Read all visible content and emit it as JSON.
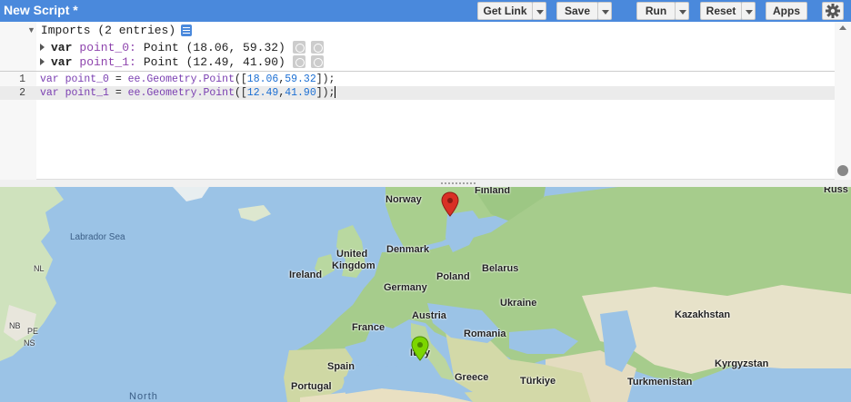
{
  "header": {
    "title": "New Script *",
    "buttons": {
      "get_link": "Get Link",
      "save": "Save",
      "run": "Run",
      "reset": "Reset",
      "apps": "Apps"
    },
    "accent_color": "#4a89dc"
  },
  "imports": {
    "heading": "Imports (2 entries)",
    "entries": [
      {
        "keyword": "var",
        "name": "point_0:",
        "value": "Point (18.06, 59.32)"
      },
      {
        "keyword": "var",
        "name": "point_1:",
        "value": "Point (12.49, 41.90)"
      }
    ]
  },
  "code": {
    "lines": [
      {
        "number": "1",
        "var": "var",
        "ident": "point_0",
        "eq": " = ",
        "call": "ee.Geometry.Point",
        "open": "([",
        "a": "18.06",
        "comma": ",",
        "b": "59.32",
        "close": "]);"
      },
      {
        "number": "2",
        "var": "var",
        "ident": "point_1",
        "eq": " = ",
        "call": "ee.Geometry.Point",
        "open": "([",
        "a": "12.49",
        "comma": ",",
        "b": "41.90",
        "close": "]);"
      }
    ]
  },
  "map": {
    "labels": {
      "finland": "Finland",
      "norway": "Norway",
      "russia": "Russ",
      "labrador_sea": "Labrador Sea",
      "united_kingdom_1": "United",
      "united_kingdom_2": "Kingdom",
      "ireland": "Ireland",
      "denmark": "Denmark",
      "poland": "Poland",
      "belarus": "Belarus",
      "germany": "Germany",
      "ukraine": "Ukraine",
      "austria": "Austria",
      "kazakhstan": "Kazakhstan",
      "france": "France",
      "romania": "Romania",
      "italy": "Italy",
      "spain": "Spain",
      "kyrgyzstan": "Kyrgyzstan",
      "portugal": "Portugal",
      "greece": "Greece",
      "turkiye": "Türkiye",
      "turkmenistan": "Turkmenistan",
      "north": "North",
      "nl": "NL",
      "nb": "NB",
      "pe": "PE",
      "ns": "NS"
    },
    "markers": [
      {
        "name": "point_0",
        "color": "#d93025"
      },
      {
        "name": "point_1",
        "color": "#7cd600"
      }
    ]
  }
}
